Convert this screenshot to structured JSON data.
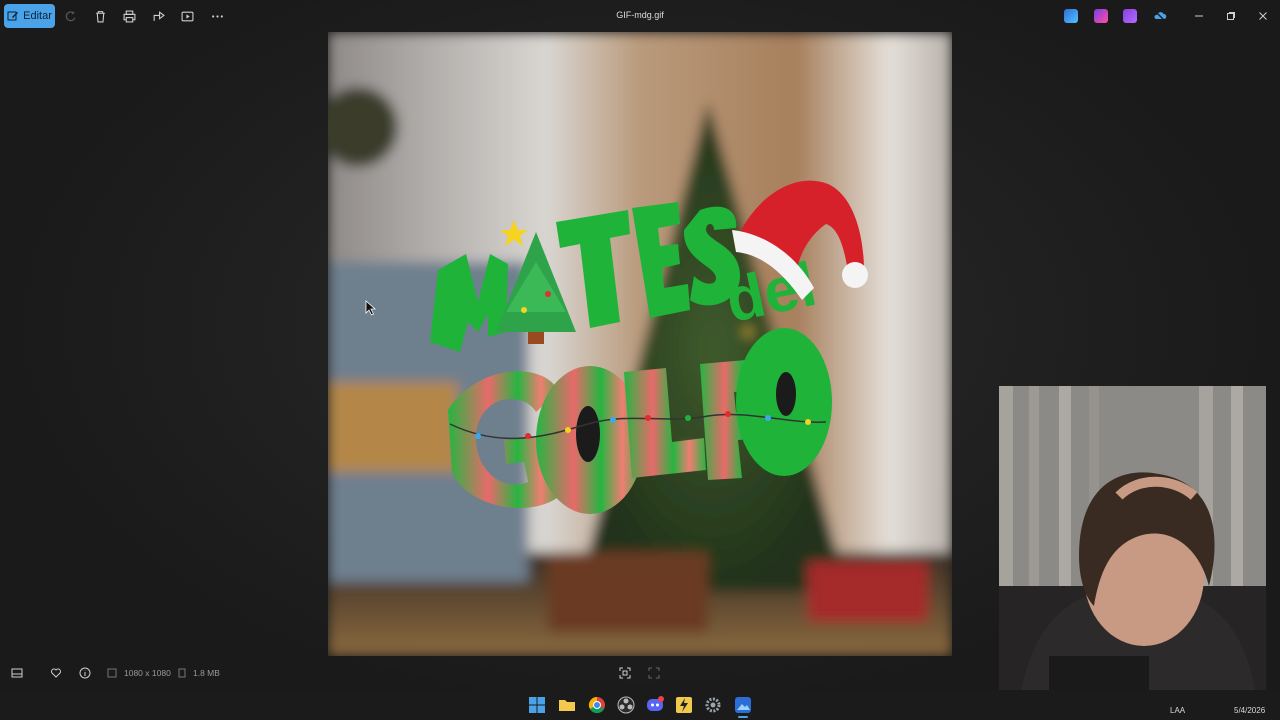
{
  "toolbar": {
    "edit_label": "Editar",
    "title": "GIF-mdg.gif",
    "icons": [
      "edit-icon",
      "rotate-icon",
      "delete-icon",
      "print-icon",
      "share-icon",
      "slideshow-icon",
      "more-icon"
    ]
  },
  "image": {
    "logo_word_1": "M  TES",
    "logo_word_2": "del",
    "logo_word_3": "GOLFO"
  },
  "status": {
    "dimensions": "1080 x 1080",
    "size": "1.8 MB"
  },
  "taskbar": {
    "language": "LAA",
    "date": "5/4/2026"
  },
  "colors": {
    "accent": "#4aa3e8",
    "logo_green": "#1fb33a",
    "hat_red": "#d6202a"
  }
}
